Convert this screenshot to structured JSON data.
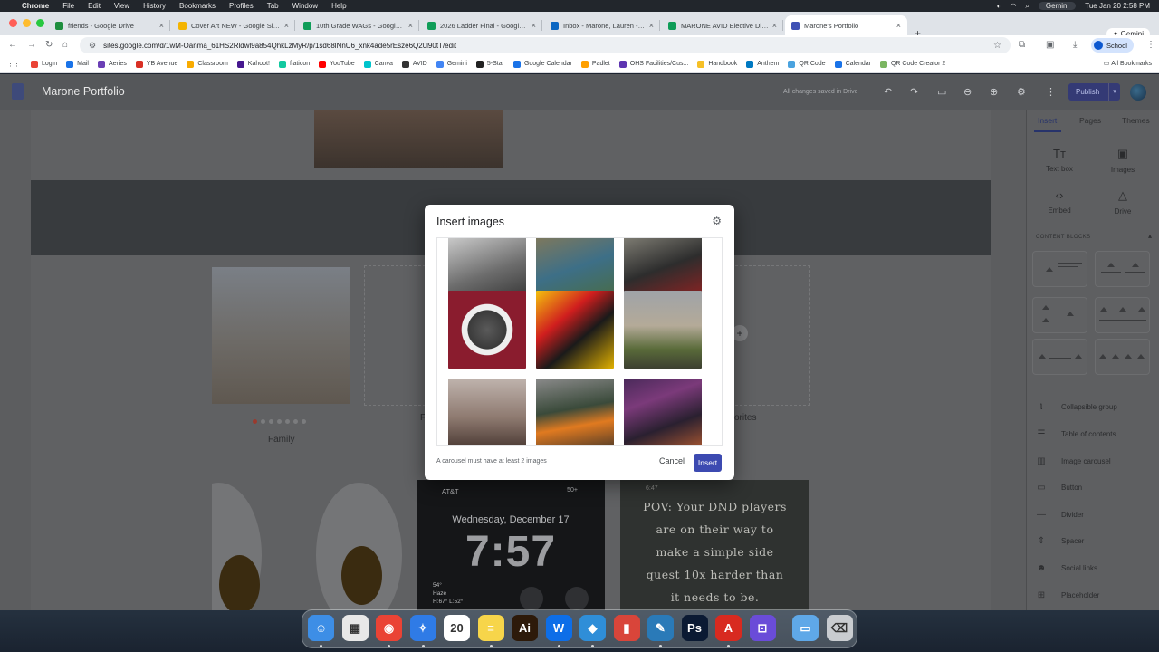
{
  "menubar": {
    "app": "Chrome",
    "items": [
      "File",
      "Edit",
      "View",
      "History",
      "Bookmarks",
      "Profiles",
      "Tab",
      "Window",
      "Help"
    ],
    "gemini": "Gemini",
    "datetime": "Tue Jan 20  2:58 PM"
  },
  "tabs": [
    {
      "title": "friends - Google Drive",
      "color": "#1e8e3e"
    },
    {
      "title": "Cover Art NEW - Google Slides",
      "color": "#f4b400"
    },
    {
      "title": "10th Grade WAGs - Google Sheets",
      "color": "#0f9d58"
    },
    {
      "title": "2026 Ladder Final - Google Sheets",
      "color": "#0f9d58"
    },
    {
      "title": "Inbox - Marone, Lauren - Outlook",
      "color": "#0a66c2"
    },
    {
      "title": "MARONE AVID Elective Digital",
      "color": "#0f9d58"
    },
    {
      "title": "Marone's Portfolio",
      "color": "#3f51b5"
    }
  ],
  "address": {
    "url": "sites.google.com/d/1wM-Oanma_61HS2Rldwl9a854QhkLzMyR/p/1sd68lNnU6_xnk4ade5rEsze6Q20l90tT/edit",
    "profile": "School"
  },
  "bookmarks": [
    {
      "label": "Login",
      "color": "#ea4335"
    },
    {
      "label": "Mail",
      "color": "#1a73e8"
    },
    {
      "label": "Aeries",
      "color": "#6a3fb5"
    },
    {
      "label": "YB Avenue",
      "color": "#d93025"
    },
    {
      "label": "Classroom",
      "color": "#f9ab00"
    },
    {
      "label": "Kahoot!",
      "color": "#46178f"
    },
    {
      "label": "flaticon",
      "color": "#12c9a0"
    },
    {
      "label": "YouTube",
      "color": "#ff0000"
    },
    {
      "label": "Canva",
      "color": "#00c4cc"
    },
    {
      "label": "AVID",
      "color": "#333333"
    },
    {
      "label": "Gemini",
      "color": "#4285f4"
    },
    {
      "label": "5-Star",
      "color": "#222222"
    },
    {
      "label": "Google Calendar",
      "color": "#1a73e8"
    },
    {
      "label": "Padlet",
      "color": "#ffa000"
    },
    {
      "label": "OHS Facilities/Cus...",
      "color": "#5e35b1"
    },
    {
      "label": "Handbook",
      "color": "#f6c026"
    },
    {
      "label": "Anthem",
      "color": "#0079c2"
    },
    {
      "label": "QR Code",
      "color": "#4aa3df"
    },
    {
      "label": "Calendar",
      "color": "#1a73e8"
    },
    {
      "label": "QR Code Creator 2",
      "color": "#7bb661"
    }
  ],
  "all_bookmarks": "All Bookmarks",
  "sites": {
    "title": "Marone Portfolio",
    "saved_status": "All changes saved in Drive",
    "publish": "Publish"
  },
  "canvas": {
    "family_caption": "Family",
    "partial_caption_left": "F",
    "partial_caption_right": "vorites",
    "phone": {
      "carrier": "AT&T",
      "battery": "50+",
      "date": "Wednesday, December 17",
      "time": "7:57",
      "weather_temp": "54°",
      "weather_cond": "Haze",
      "weather_range": "H:67° L:52°"
    },
    "meme": {
      "time": "6:47",
      "lines": [
        "POV: Your DND players",
        "are on their way to",
        "make a simple side",
        "quest 10x harder than",
        "it needs to be."
      ]
    }
  },
  "panel": {
    "tabs": [
      "Insert",
      "Pages",
      "Themes"
    ],
    "tools": [
      {
        "label": "Text box",
        "icon": "text-box-icon"
      },
      {
        "label": "Images",
        "icon": "image-icon"
      },
      {
        "label": "Embed",
        "icon": "embed-icon"
      },
      {
        "label": "Drive",
        "icon": "drive-icon"
      }
    ],
    "content_blocks_heading": "CONTENT BLOCKS",
    "items": [
      {
        "label": "Collapsible group",
        "icon": "collapsible-icon"
      },
      {
        "label": "Table of contents",
        "icon": "toc-icon"
      },
      {
        "label": "Image carousel",
        "icon": "carousel-icon"
      },
      {
        "label": "Button",
        "icon": "button-icon"
      },
      {
        "label": "Divider",
        "icon": "divider-icon"
      },
      {
        "label": "Spacer",
        "icon": "spacer-icon"
      },
      {
        "label": "Social links",
        "icon": "social-icon"
      },
      {
        "label": "Placeholder",
        "icon": "placeholder-icon"
      }
    ]
  },
  "dialog": {
    "title": "Insert images",
    "note": "A carousel must have at least 2 images",
    "cancel": "Cancel",
    "insert": "Insert",
    "thumbnails": [
      {
        "name": "photo-1",
        "bg": "linear-gradient(160deg,#d9d9d9,#6d6d6d 55%,#2c2c2c)"
      },
      {
        "name": "photo-2",
        "bg": "linear-gradient(160deg,#8a7a55,#3d6f87 50%,#4b6b3a)"
      },
      {
        "name": "photo-3",
        "bg": "linear-gradient(160deg,#8d8b80,#2d2d2d 50%,#a02020)"
      },
      {
        "name": "photo-4",
        "bg": "radial-gradient(circle at 50% 50%,#5a5a5a 0,#3a3a3a 35%,#eee 36%,#eee 46%,#8a1c2e 47%)"
      },
      {
        "name": "photo-5",
        "bg": "linear-gradient(140deg,#f4c20d,#d01e1e 35%,#1a1a1a 60%,#e0b000)"
      },
      {
        "name": "photo-6",
        "bg": "linear-gradient(180deg,#9fa3a8,#b4aa98 45%,#5a6b3a 75%,#3c3f30)"
      },
      {
        "name": "photo-7",
        "bg": "linear-gradient(180deg,#bfb3ad,#8e7a70 50%,#3a2a25)"
      },
      {
        "name": "photo-8",
        "bg": "linear-gradient(170deg,#8a8a8a,#3a4a3a 40%,#e07a20 60%,#2a2a2a)"
      },
      {
        "name": "photo-9",
        "bg": "linear-gradient(160deg,#4a2a5a,#7b3a7a 30%,#2a2030 60%,#c06030)"
      }
    ]
  },
  "dock": [
    {
      "name": "finder",
      "color": "#3d8ee6",
      "glyph": "☺"
    },
    {
      "name": "launchpad",
      "color": "#e8e8e8",
      "glyph": "▦"
    },
    {
      "name": "chrome",
      "color": "#ea4335",
      "glyph": "◉"
    },
    {
      "name": "safari",
      "color": "#2f7be6",
      "glyph": "✧"
    },
    {
      "name": "calendar",
      "color": "#ffffff",
      "glyph": "20"
    },
    {
      "name": "notes",
      "color": "#f7d54a",
      "glyph": "≡"
    },
    {
      "name": "illustrator",
      "color": "#2d1a0a",
      "glyph": "Ai"
    },
    {
      "name": "webex",
      "color": "#0d6ee8",
      "glyph": "W"
    },
    {
      "name": "maps",
      "color": "#2f8ed8",
      "glyph": "◆"
    },
    {
      "name": "phone",
      "color": "#d9453a",
      "glyph": "▮"
    },
    {
      "name": "reading",
      "color": "#2a7ab8",
      "glyph": "✎"
    },
    {
      "name": "photoshop",
      "color": "#0b1a33",
      "glyph": "Ps"
    },
    {
      "name": "acrobat",
      "color": "#d82a20",
      "glyph": "A"
    },
    {
      "name": "mirror",
      "color": "#6a4cd8",
      "glyph": "⊡"
    },
    {
      "name": "folder",
      "color": "#5fa8e8",
      "glyph": "▭"
    },
    {
      "name": "trash",
      "color": "#c9ccd0",
      "glyph": "⌫"
    }
  ]
}
